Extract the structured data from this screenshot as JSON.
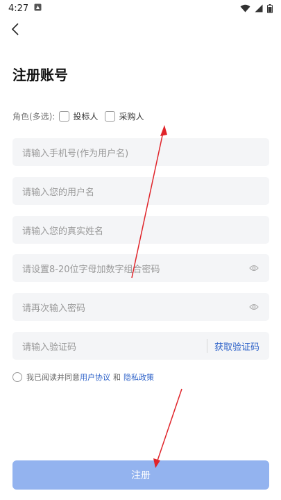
{
  "status_bar": {
    "time": "4:27"
  },
  "page": {
    "title": "注册账号"
  },
  "role": {
    "label": "角色(多选):",
    "options": [
      "投标人",
      "采购人"
    ]
  },
  "fields": {
    "phone_placeholder": "请输入手机号(作为用户名)",
    "username_placeholder": "请输入您的用户名",
    "realname_placeholder": "请输入您的真实姓名",
    "password_placeholder": "请设置8-20位字母加数字组合密码",
    "confirm_placeholder": "请再次输入密码",
    "code_placeholder": "请输入验证码",
    "get_code_label": "获取验证码"
  },
  "agreement": {
    "prefix": "我已阅读并同意",
    "user_agreement": "用户协议",
    "and": "和",
    "privacy_policy": "隐私政策"
  },
  "submit_label": "注册",
  "colors": {
    "accent": "#2f63c9",
    "submit_bg": "#93b3ef",
    "field_bg": "#f4f5f7",
    "annotation": "#e0242a"
  }
}
